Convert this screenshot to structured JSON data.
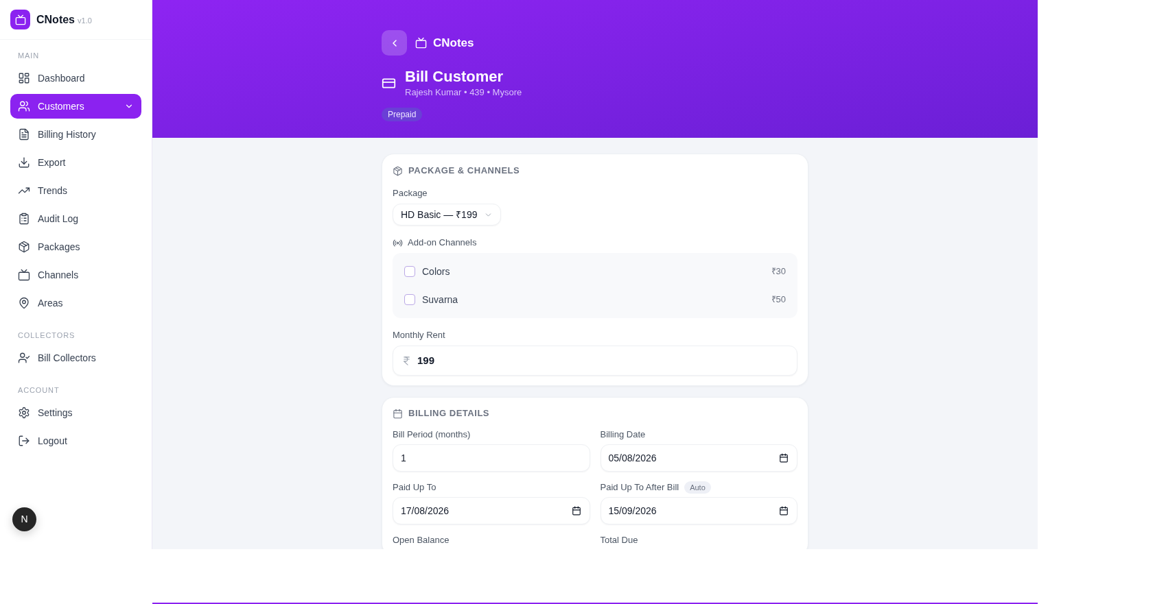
{
  "sidebar": {
    "brand": {
      "name": "CNotes",
      "version": "v1.0"
    },
    "sections": [
      {
        "title": "MAIN",
        "items": [
          {
            "label": "Dashboard",
            "selected": false,
            "expandable": false
          },
          {
            "label": "Customers",
            "selected": true,
            "expandable": true
          },
          {
            "label": "Billing History",
            "selected": false,
            "expandable": false
          },
          {
            "label": "Export",
            "selected": false,
            "expandable": false
          },
          {
            "label": "Trends",
            "selected": false,
            "expandable": false
          },
          {
            "label": "Audit Log",
            "selected": false,
            "expandable": false
          },
          {
            "label": "Packages",
            "selected": false,
            "expandable": false
          },
          {
            "label": "Channels",
            "selected": false,
            "expandable": false
          },
          {
            "label": "Areas",
            "selected": false,
            "expandable": false
          }
        ]
      },
      {
        "title": "COLLECTORS",
        "items": [
          {
            "label": "Bill Collectors",
            "selected": false,
            "expandable": false
          }
        ]
      },
      {
        "title": "ACCOUNT",
        "items": [
          {
            "label": "Settings",
            "selected": false,
            "expandable": false
          },
          {
            "label": "Logout",
            "selected": false,
            "expandable": false
          }
        ]
      }
    ],
    "dev_badge": "N"
  },
  "header": {
    "app_name": "CNotes",
    "title": "Bill Customer",
    "subtitle": "Rajesh Kumar • 439 • Mysore",
    "badge": "Prepaid"
  },
  "package_card": {
    "title": "PACKAGE & CHANNELS",
    "package_label": "Package",
    "package_value": "HD Basic — ₹199",
    "addons_label": "Add-on Channels",
    "addons": [
      {
        "name": "Colors",
        "price": "₹30",
        "checked": false
      },
      {
        "name": "Suvarna",
        "price": "₹50",
        "checked": false
      }
    ],
    "rent_label": "Monthly Rent",
    "rent_value": "199"
  },
  "billing_card": {
    "title": "BILLING DETAILS",
    "fields": [
      {
        "label": "Bill Period (months)",
        "kind": "number",
        "value": "1"
      },
      {
        "label": "Billing Date",
        "kind": "date",
        "value": "05/08/2026"
      },
      {
        "label": "Paid Up To",
        "kind": "date",
        "value": "17/08/2026"
      },
      {
        "label": "Paid Up To After Bill",
        "kind": "date",
        "badge": "Auto",
        "value": "15/09/2026"
      },
      {
        "label": "Open Balance"
      },
      {
        "label": "Total Due"
      }
    ]
  }
}
